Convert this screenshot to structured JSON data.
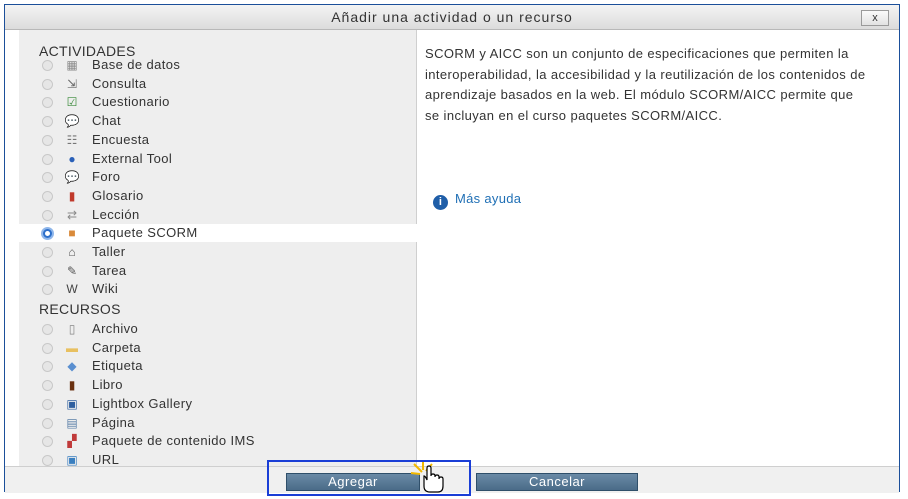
{
  "dialog": {
    "title": "Añadir una actividad o un recurso",
    "close_label": "x"
  },
  "activities": {
    "heading": "ACTIVIDADES",
    "items": [
      {
        "label": "Base de datos",
        "icon": "database-icon",
        "glyph": "▦",
        "color": "#8a8a8a"
      },
      {
        "label": "Consulta",
        "icon": "choice-icon",
        "glyph": "⇲",
        "color": "#666666"
      },
      {
        "label": "Cuestionario",
        "icon": "quiz-icon",
        "glyph": "☑",
        "color": "#3a8a3a"
      },
      {
        "label": "Chat",
        "icon": "chat-icon",
        "glyph": "💬",
        "color": "#e0a800"
      },
      {
        "label": "Encuesta",
        "icon": "survey-icon",
        "glyph": "☷",
        "color": "#777777"
      },
      {
        "label": "External Tool",
        "icon": "external-tool-icon",
        "glyph": "●",
        "color": "#2a60b8"
      },
      {
        "label": "Foro",
        "icon": "forum-icon",
        "glyph": "💬",
        "color": "#e8b830"
      },
      {
        "label": "Glosario",
        "icon": "glossary-icon",
        "glyph": "▮",
        "color": "#c0392b"
      },
      {
        "label": "Lección",
        "icon": "lesson-icon",
        "glyph": "⇄",
        "color": "#888888"
      },
      {
        "label": "Paquete SCORM",
        "icon": "scorm-package-icon",
        "glyph": "■",
        "color": "#d98a3a",
        "selected": true
      },
      {
        "label": "Taller",
        "icon": "workshop-icon",
        "glyph": "⌂",
        "color": "#555555"
      },
      {
        "label": "Tarea",
        "icon": "assignment-icon",
        "glyph": "✎",
        "color": "#555555"
      },
      {
        "label": "Wiki",
        "icon": "wiki-icon",
        "glyph": "W",
        "color": "#444444"
      }
    ]
  },
  "resources": {
    "heading": "RECURSOS",
    "items": [
      {
        "label": "Archivo",
        "icon": "file-icon",
        "glyph": "▯",
        "color": "#888888"
      },
      {
        "label": "Carpeta",
        "icon": "folder-icon",
        "glyph": "▬",
        "color": "#e8c060"
      },
      {
        "label": "Etiqueta",
        "icon": "label-icon",
        "glyph": "◆",
        "color": "#5a8fd0"
      },
      {
        "label": "Libro",
        "icon": "book-icon",
        "glyph": "▮",
        "color": "#6a3010"
      },
      {
        "label": "Lightbox Gallery",
        "icon": "gallery-icon",
        "glyph": "▣",
        "color": "#2f5f9f"
      },
      {
        "label": "Página",
        "icon": "page-icon",
        "glyph": "▤",
        "color": "#5a7fa8"
      },
      {
        "label": "Paquete de contenido IMS",
        "icon": "ims-package-icon",
        "glyph": "▞",
        "color": "#c03a3a"
      },
      {
        "label": "URL",
        "icon": "url-icon",
        "glyph": "▣",
        "color": "#3a7fc0"
      }
    ]
  },
  "description": {
    "text": "SCORM y AICC son un conjunto de especificaciones que permiten la interoperabilidad, la accesibilidad y la reutilización de los contenidos de aprendizaje basados en la web. El módulo SCORM/AICC permite que se incluyan en el curso paquetes SCORM/AICC.",
    "help_label": "Más ayuda"
  },
  "footer": {
    "add_label": "Agregar",
    "cancel_label": "Cancelar"
  }
}
